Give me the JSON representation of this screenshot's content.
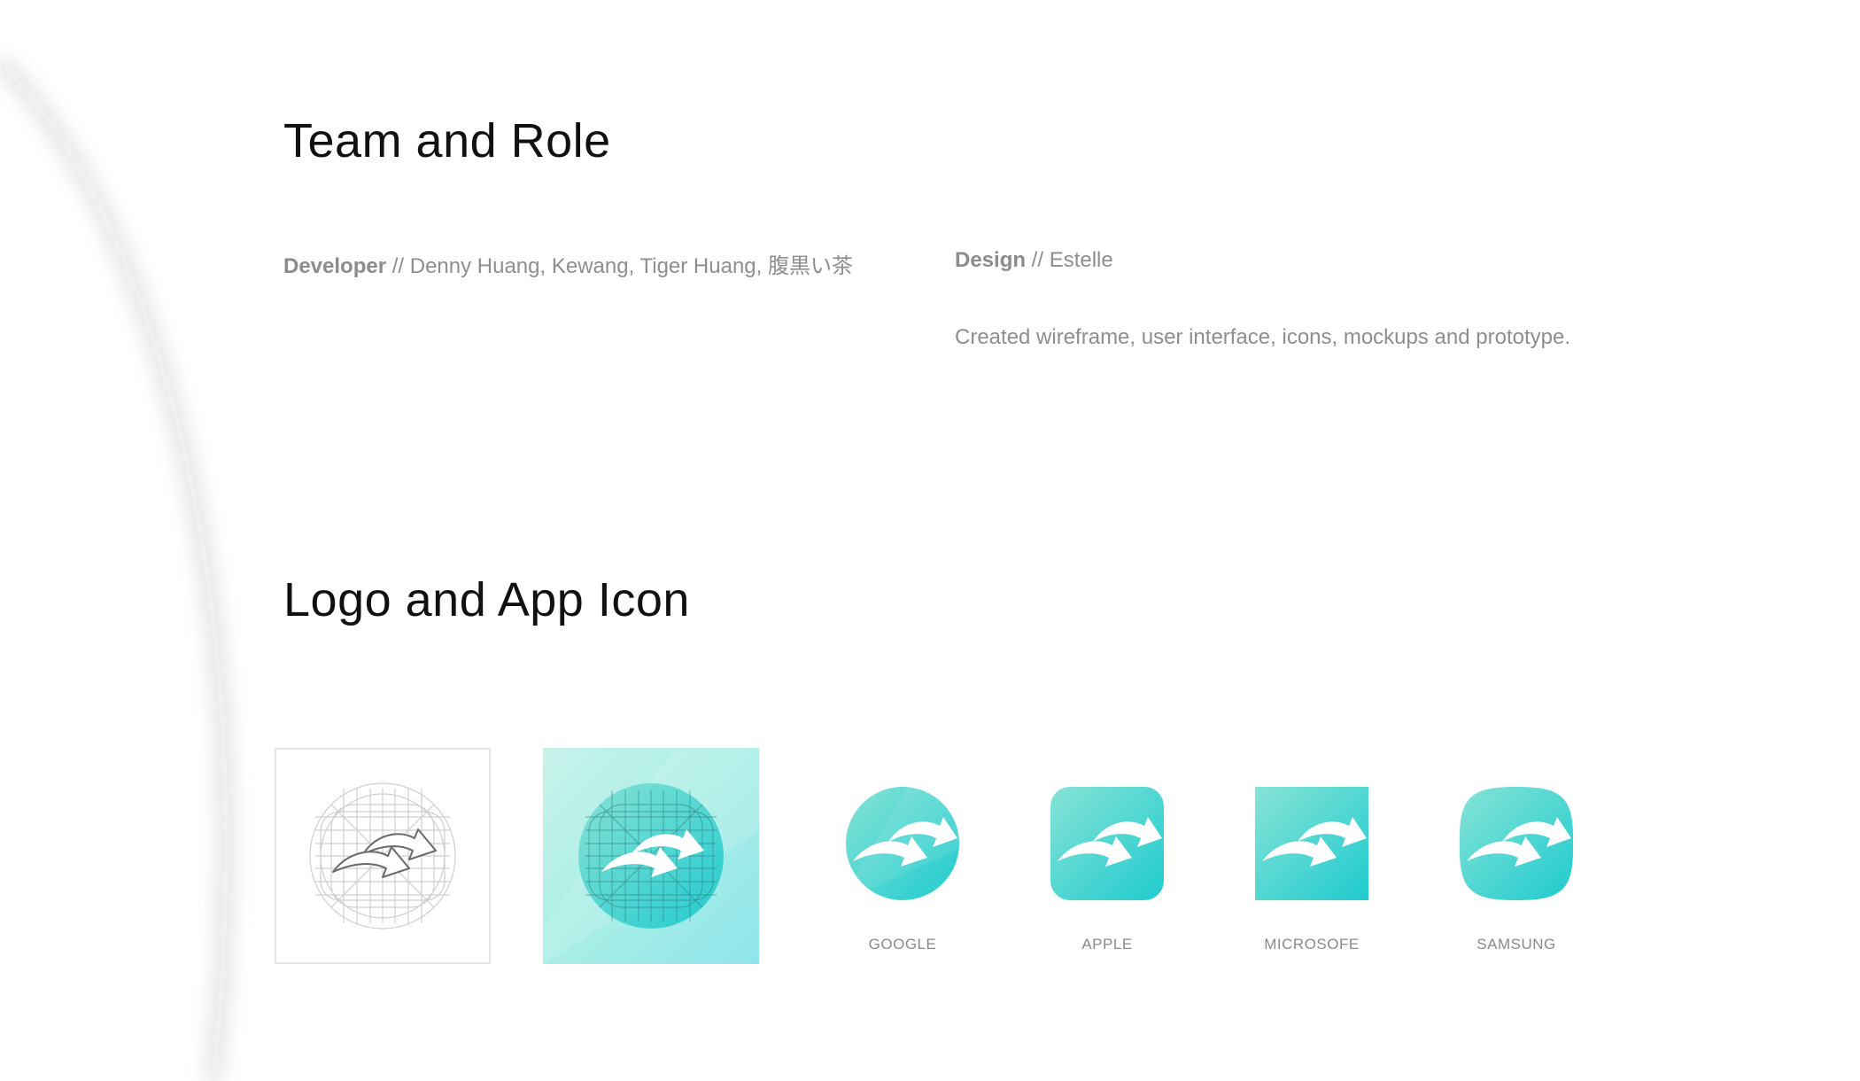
{
  "team": {
    "heading": "Team and Role",
    "developer_role": "Developer",
    "developer_names": " // Denny Huang, Kewang, Tiger Huang, 腹黒い茶",
    "design_role": "Design",
    "design_names": " // Estelle",
    "design_description": "Created wireframe, user interface, icons, mockups and prototype."
  },
  "logo": {
    "heading": "Logo and App Icon",
    "platforms": [
      {
        "label": "GOOGLE"
      },
      {
        "label": "APPLE"
      },
      {
        "label": "MICROSOFE"
      },
      {
        "label": "SAMSUNG"
      }
    ]
  },
  "colors": {
    "teal_light": "#7fe0d4",
    "teal_dark": "#20cbcf",
    "background_glow": "#e9e9e9",
    "grid_line": "#c8c8c8"
  },
  "icons": {
    "app_glyph": "double-forward-arrow-icon"
  }
}
